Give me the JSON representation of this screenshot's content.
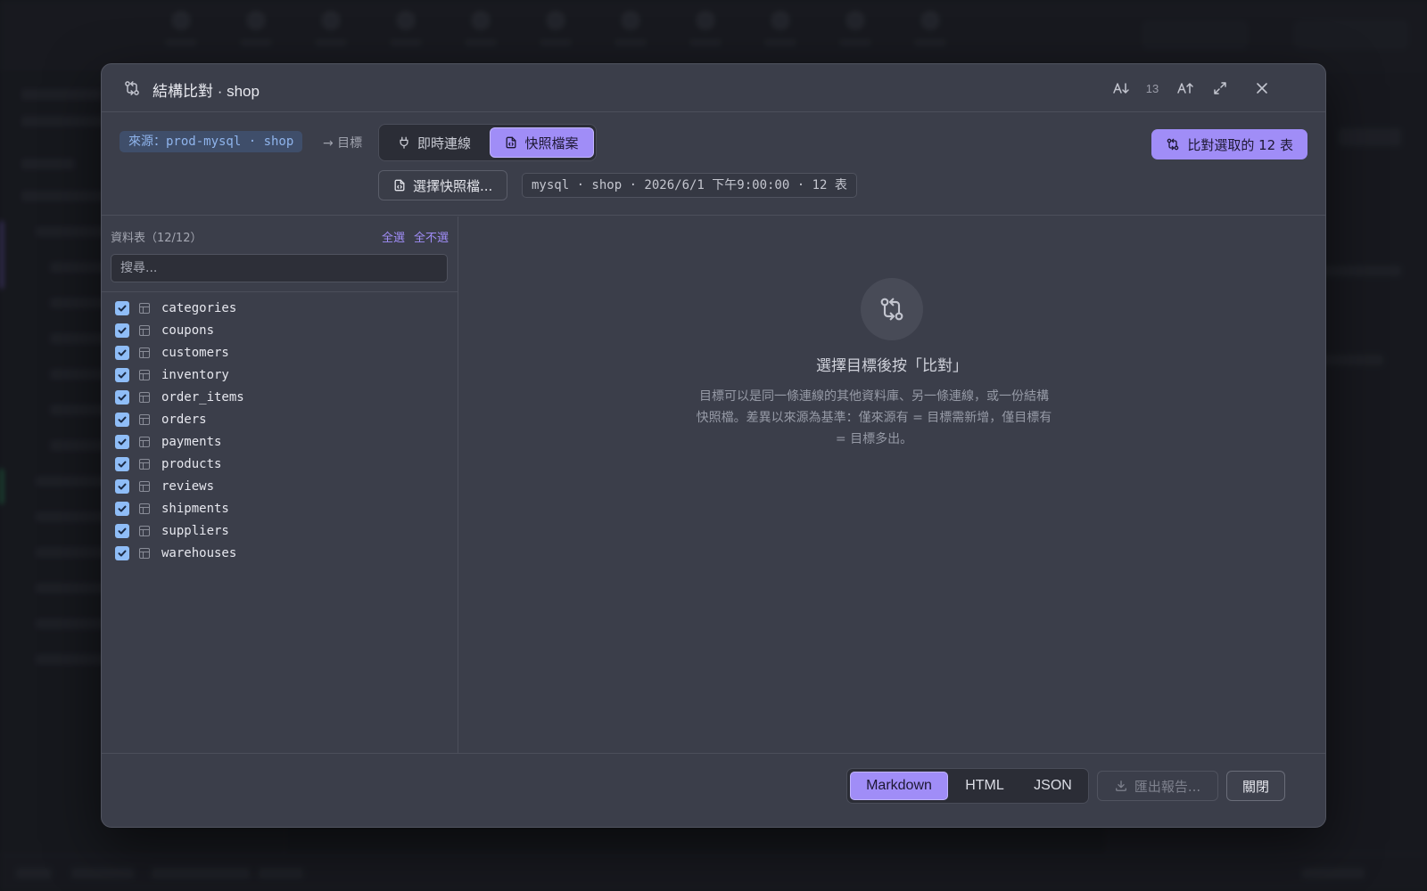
{
  "modal": {
    "title": "結構比對 · shop",
    "font_size": "13",
    "icons": [
      "git-compare-icon",
      "font-decrease-icon",
      "font-increase-icon",
      "expand-icon",
      "close-icon"
    ]
  },
  "toolbar": {
    "source_label": "來源：prod-mysql · shop",
    "target_label": "→ 目標",
    "mode_live": "即時連線",
    "mode_snapshot": "快照檔案",
    "compare_button": "比對選取的 12 表",
    "pick_snapshot": "選擇快照檔...",
    "snapshot_info": "mysql · shop · 2026/6/1 下午9:00:00 · 12 表"
  },
  "tables_panel": {
    "header": "資料表（12/12）",
    "select_all": "全選",
    "select_none": "全不選",
    "search_placeholder": "搜尋...",
    "items": [
      {
        "name": "categories",
        "checked": true
      },
      {
        "name": "coupons",
        "checked": true
      },
      {
        "name": "customers",
        "checked": true
      },
      {
        "name": "inventory",
        "checked": true
      },
      {
        "name": "order_items",
        "checked": true
      },
      {
        "name": "orders",
        "checked": true
      },
      {
        "name": "payments",
        "checked": true
      },
      {
        "name": "products",
        "checked": true
      },
      {
        "name": "reviews",
        "checked": true
      },
      {
        "name": "shipments",
        "checked": true
      },
      {
        "name": "suppliers",
        "checked": true
      },
      {
        "name": "warehouses",
        "checked": true
      }
    ]
  },
  "empty_state": {
    "title": "選擇目標後按「比對」",
    "description": "目標可以是同一條連線的其他資料庫、另一條連線，或一份結構快照檔。差異以來源為基準：僅來源有 = 目標需新增，僅目標有 = 目標多出。"
  },
  "footer": {
    "formats": [
      "Markdown",
      "HTML",
      "JSON"
    ],
    "active_format": "Markdown",
    "export_button": "匯出報告...",
    "close_button": "關閉"
  },
  "colors": {
    "accent": "#a08df7",
    "checkbox": "#8fbdf7",
    "modal_bg": "#3b3e4a"
  }
}
